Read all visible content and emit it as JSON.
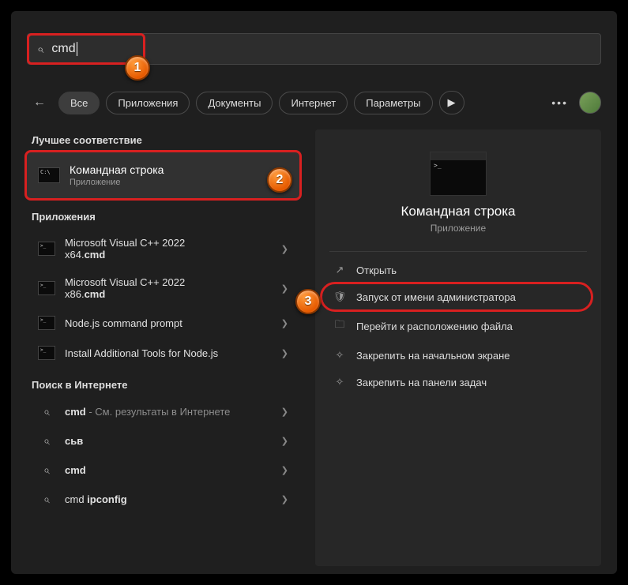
{
  "search": {
    "value": "cmd"
  },
  "tabs": {
    "items": [
      "Все",
      "Приложения",
      "Документы",
      "Интернет",
      "Параметры"
    ],
    "activeIndex": 0
  },
  "sections": {
    "bestMatch": "Лучшее соответствие",
    "apps": "Приложения",
    "web": "Поиск в Интернете"
  },
  "bestMatch": {
    "title": "Командная строка",
    "subtitle": "Приложение"
  },
  "appResults": [
    {
      "line1": "Microsoft Visual C++ 2022",
      "line2_prefix": "x64.",
      "line2_bold": "cmd"
    },
    {
      "line1": "Microsoft Visual C++ 2022",
      "line2_prefix": "x86.",
      "line2_bold": "cmd"
    },
    {
      "line1": "Node.js command prompt",
      "line2_prefix": "",
      "line2_bold": ""
    },
    {
      "line1": "Install Additional Tools for Node.js",
      "line2_prefix": "",
      "line2_bold": ""
    }
  ],
  "webResults": [
    {
      "bold": "cmd",
      "rest": " - См. результаты в Интернете"
    },
    {
      "bold": "сьв",
      "rest": ""
    },
    {
      "bold": "cmd",
      "rest": ""
    },
    {
      "prefix": "cmd ",
      "bold": "ipconfig",
      "rest": ""
    }
  ],
  "preview": {
    "title": "Командная строка",
    "subtitle": "Приложение",
    "actions": [
      {
        "icon": "open",
        "label": "Открыть"
      },
      {
        "icon": "shield",
        "label": "Запуск от имени администратора"
      },
      {
        "icon": "folder",
        "label": "Перейти к расположению файла"
      },
      {
        "icon": "pin",
        "label": "Закрепить на начальном экране"
      },
      {
        "icon": "pin",
        "label": "Закрепить на панели задач"
      }
    ]
  },
  "callouts": [
    "1",
    "2",
    "3"
  ]
}
